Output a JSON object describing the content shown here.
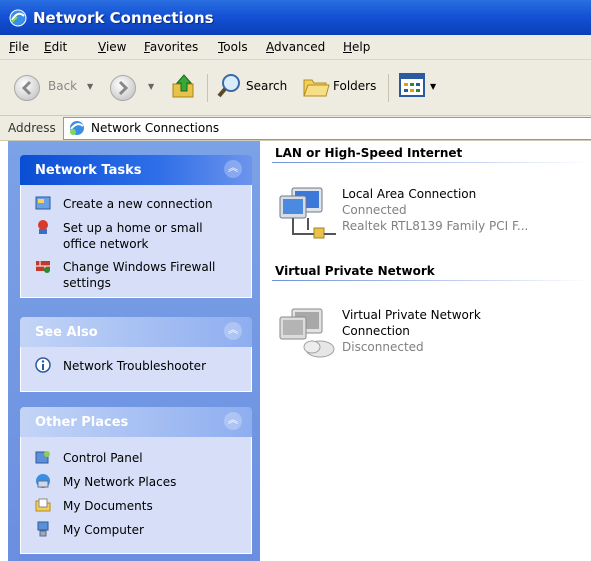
{
  "window": {
    "title": "Network Connections"
  },
  "menu": [
    "File",
    "Edit",
    "View",
    "Favorites",
    "Tools",
    "Advanced",
    "Help"
  ],
  "toolbar": {
    "back_label": "Back",
    "search_label": "Search",
    "folders_label": "Folders"
  },
  "address": {
    "label": "Address",
    "value": "Network Connections"
  },
  "panels": {
    "network_tasks": {
      "title": "Network Tasks",
      "items": [
        "Create a new connection",
        "Set up a home or small office network",
        "Change Windows Firewall settings"
      ]
    },
    "see_also": {
      "title": "See Also",
      "items": [
        "Network Troubleshooter"
      ]
    },
    "other_places": {
      "title": "Other Places",
      "items": [
        "Control Panel",
        "My Network Places",
        "My Documents",
        "My Computer"
      ]
    }
  },
  "groups": [
    {
      "header": "LAN or High-Speed Internet",
      "connection": {
        "name": "Local Area Connection",
        "status": "Connected",
        "device": "Realtek RTL8139 Family PCI F..."
      }
    },
    {
      "header": "Virtual Private Network",
      "connection": {
        "name": "Virtual Private Network Connection",
        "status": "Disconnected"
      }
    }
  ]
}
